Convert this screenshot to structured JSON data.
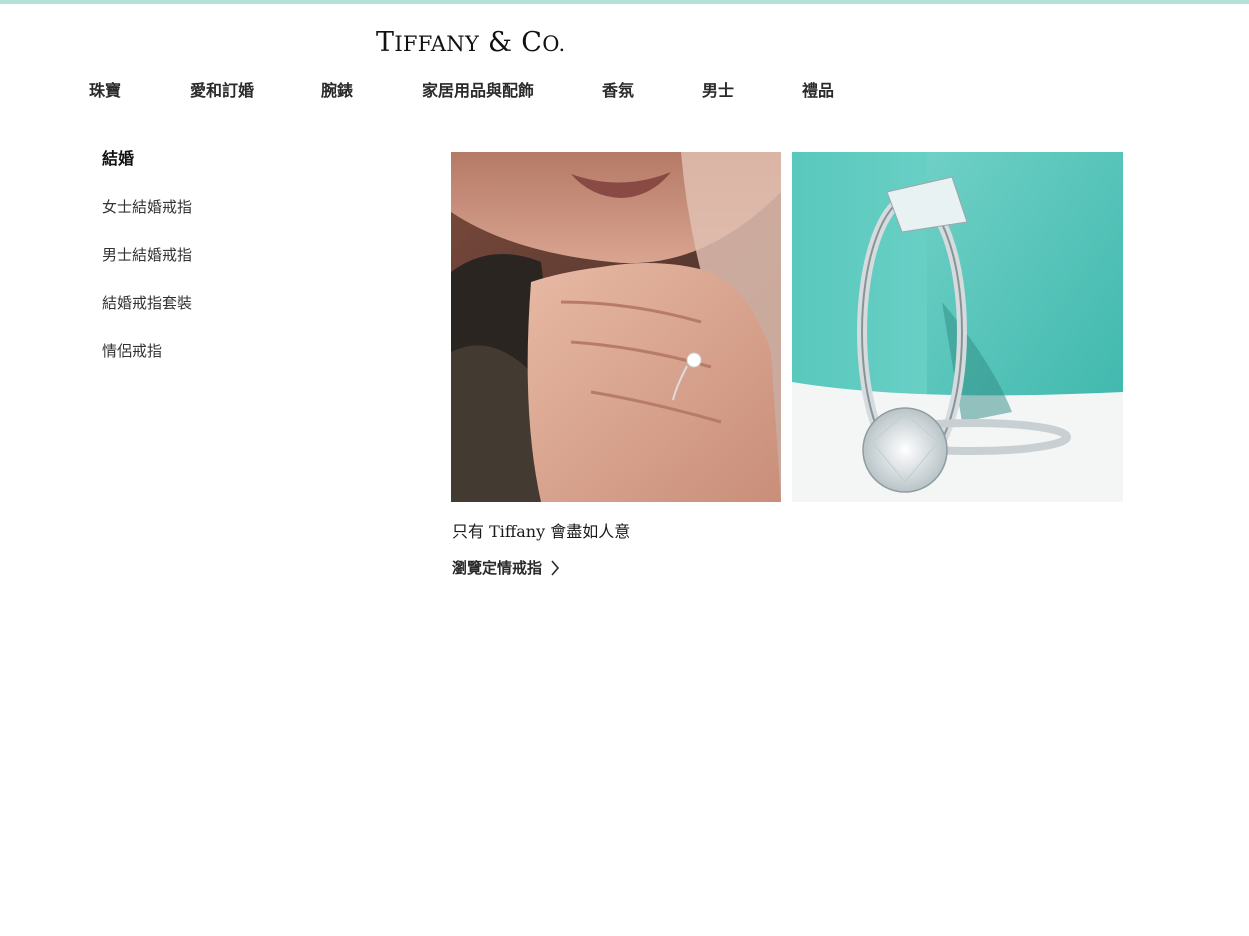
{
  "brand": {
    "logo_text": "TIFFANY & CO.",
    "accent_color": "#b5e2d7",
    "brand_blue": "#81d8d0"
  },
  "nav": {
    "items": [
      {
        "label": "珠寶"
      },
      {
        "label": "愛和訂婚"
      },
      {
        "label": "腕錶"
      },
      {
        "label": "家居用品與配飾"
      },
      {
        "label": "香氛"
      },
      {
        "label": "男士"
      },
      {
        "label": "禮品"
      }
    ]
  },
  "menu": {
    "heading": "結婚",
    "items": [
      {
        "label": "女士結婚戒指"
      },
      {
        "label": "男士結婚戒指"
      },
      {
        "label": "結婚戒指套裝"
      },
      {
        "label": "情侶戒指"
      }
    ]
  },
  "promo": {
    "caption": "只有 Tiffany 會盡如人意",
    "cta_label": "瀏覽定情戒指",
    "cta_icon": "chevron-right-icon",
    "image_left": "hands-with-engagement-ring-photo",
    "image_right": "diamond-ring-on-tiffany-blue-box-photo"
  }
}
